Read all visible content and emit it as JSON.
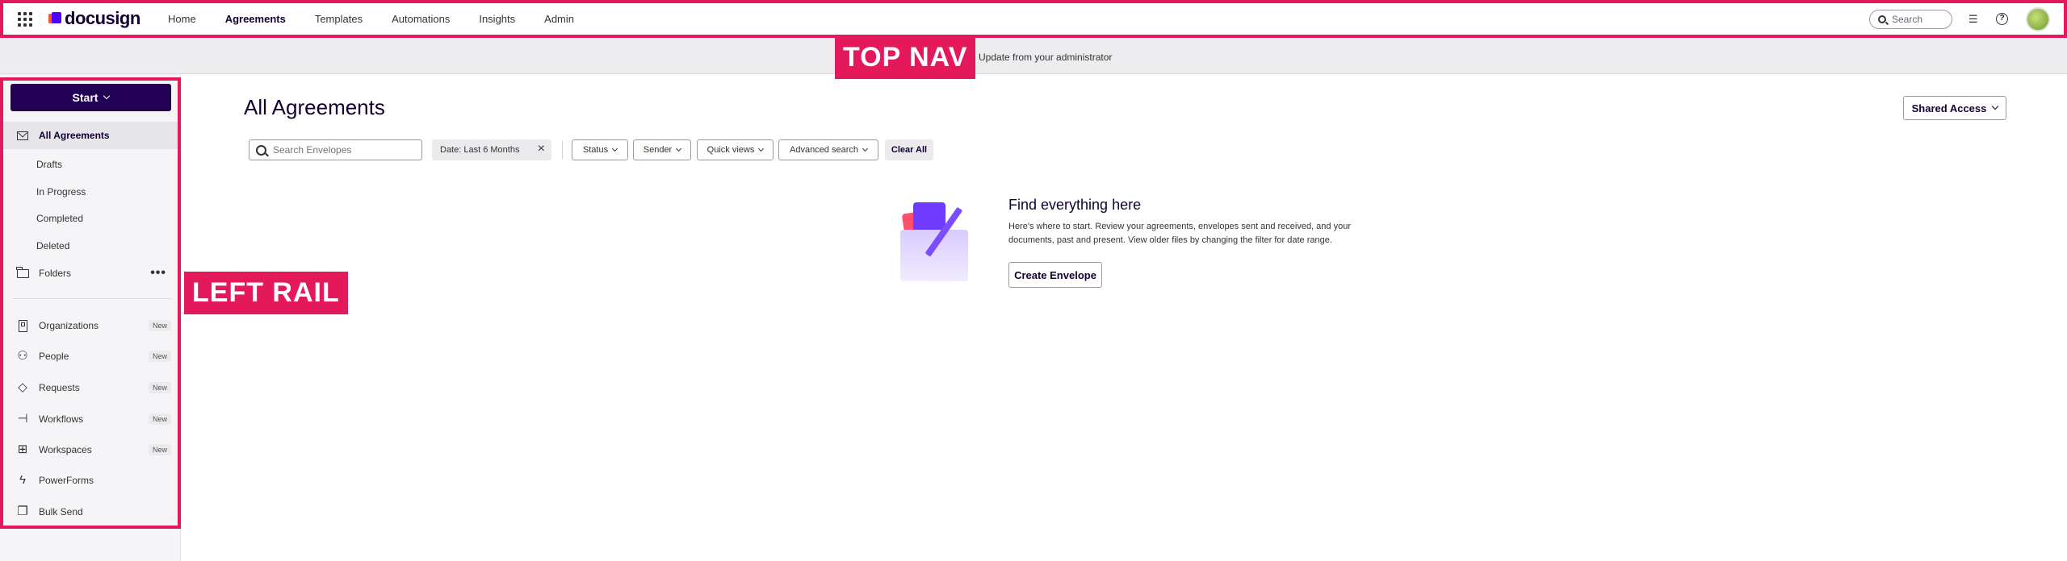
{
  "topnav": {
    "brand": "docusign",
    "links": [
      {
        "label": "Home"
      },
      {
        "label": "Agreements",
        "active": true
      },
      {
        "label": "Templates"
      },
      {
        "label": "Automations"
      },
      {
        "label": "Insights"
      },
      {
        "label": "Admin"
      }
    ],
    "search_placeholder": "Search",
    "overlay_label": "TOP NAV"
  },
  "banner": {
    "text": "Update from your administrator"
  },
  "leftrail": {
    "overlay_label": "LEFT RAIL",
    "start_label": "Start",
    "all_agreements": "All Agreements",
    "subitems": [
      "Drafts",
      "In Progress",
      "Completed",
      "Deleted"
    ],
    "folders": "Folders",
    "more": "•••",
    "tools": [
      {
        "label": "Organizations",
        "badge": "New",
        "icon": "building-icon"
      },
      {
        "label": "People",
        "badge": "New",
        "icon": "people-icon"
      },
      {
        "label": "Requests",
        "badge": "New",
        "icon": "requests-icon"
      },
      {
        "label": "Workflows",
        "badge": "New",
        "icon": "workflow-icon"
      },
      {
        "label": "Workspaces",
        "badge": "New",
        "icon": "workspaces-icon"
      },
      {
        "label": "PowerForms",
        "badge": "",
        "icon": "lightning-icon"
      },
      {
        "label": "Bulk Send",
        "badge": "",
        "icon": "bulk-send-icon"
      }
    ]
  },
  "main": {
    "title": "All Agreements",
    "shared_access": "Shared Access",
    "search_placeholder": "Search Envelopes",
    "date_chip": "Date: Last 6 Months",
    "filters": [
      "Status",
      "Sender",
      "Quick views",
      "Advanced search"
    ],
    "clear_all": "Clear All",
    "empty_state": {
      "title": "Find everything here",
      "description": "Here's where to start. Review your agreements, envelopes sent and received, and your documents, past and present. View older files by changing the filter for date range.",
      "button": "Create Envelope"
    }
  },
  "colors": {
    "accent": "#4c00ff",
    "start_button": "#220054",
    "annotation": "#e4195b"
  }
}
